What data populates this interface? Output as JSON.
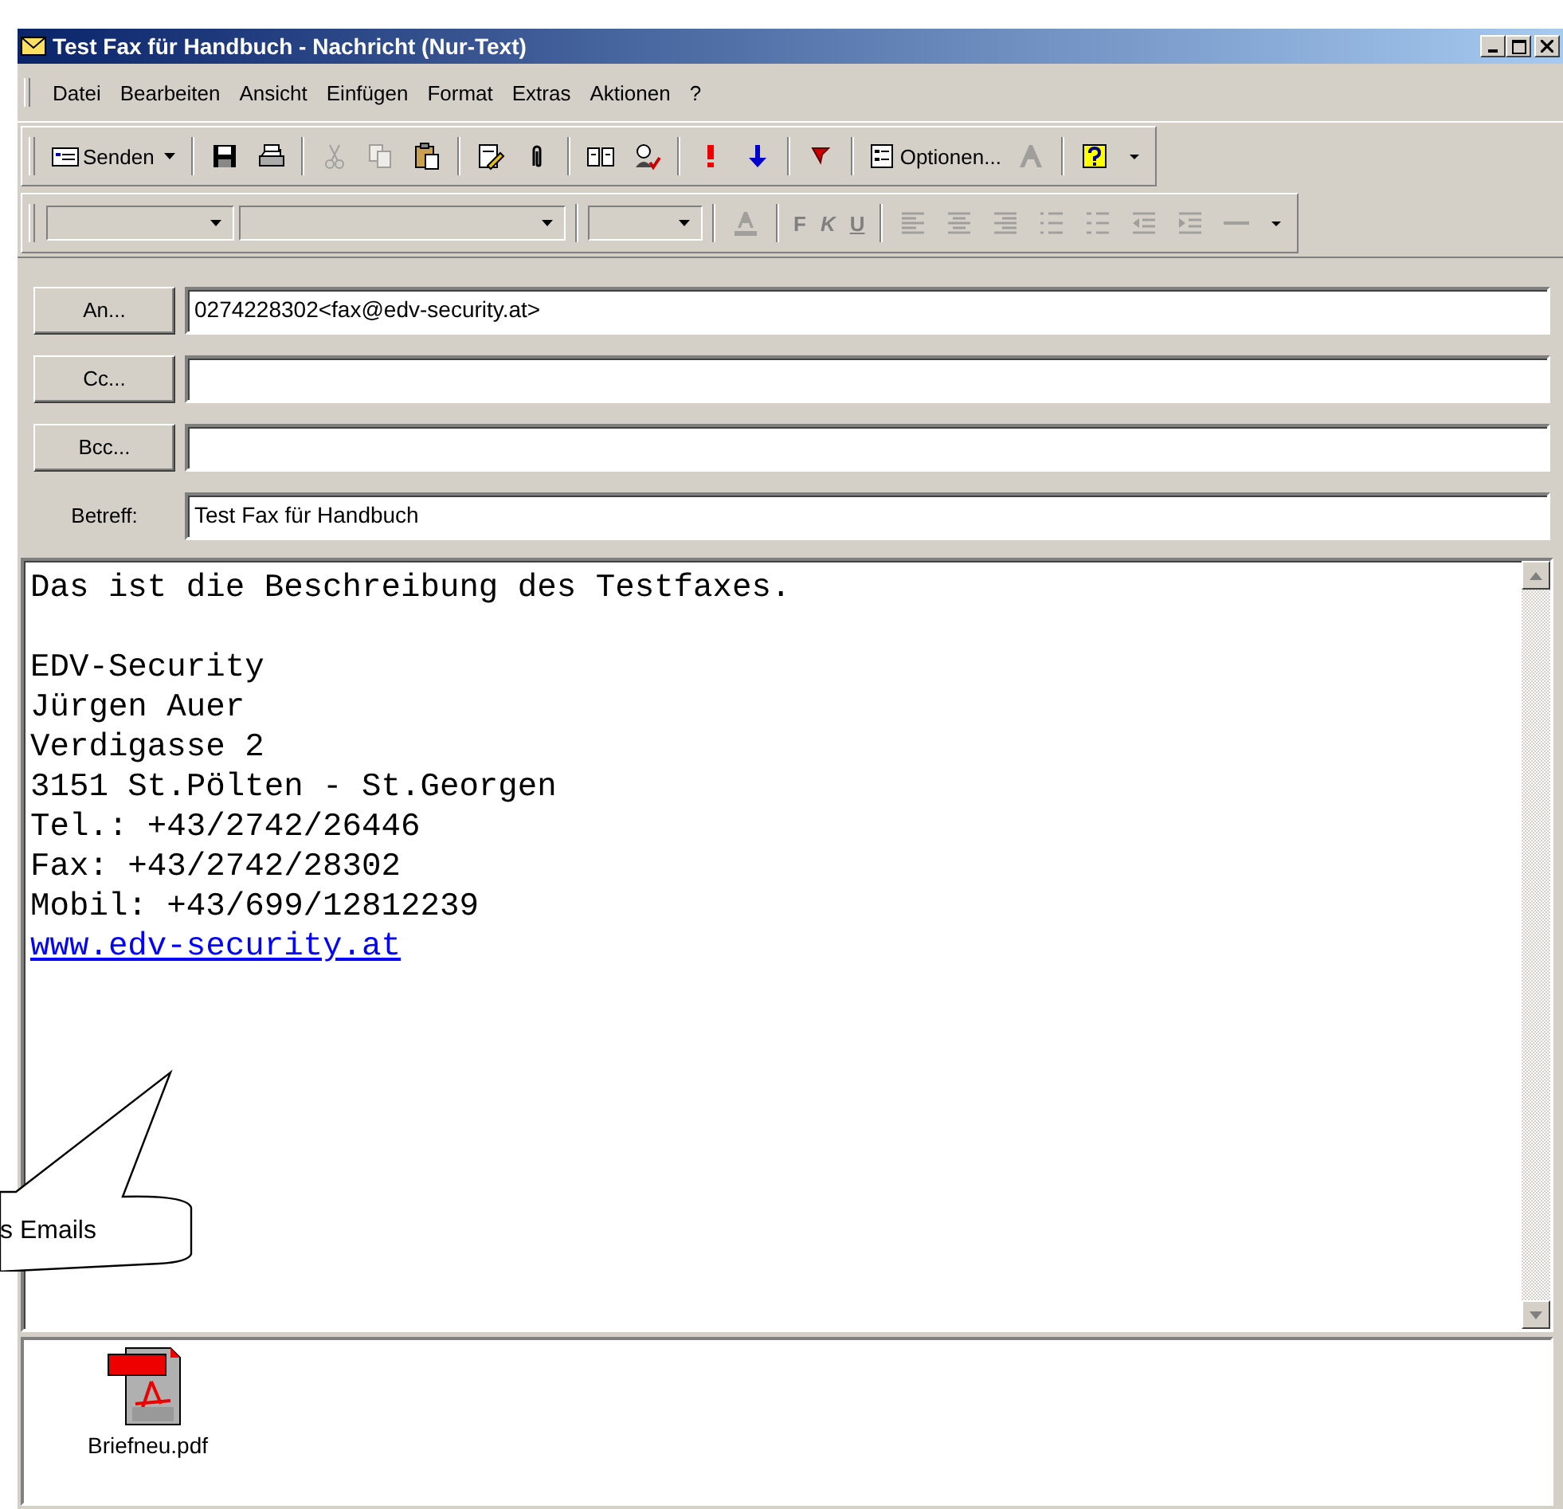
{
  "window": {
    "title": "Test Fax für Handbuch - Nachricht (Nur-Text)"
  },
  "menu": [
    "Datei",
    "Bearbeiten",
    "Ansicht",
    "Einfügen",
    "Format",
    "Extras",
    "Aktionen",
    "?"
  ],
  "toolbar": [
    {
      "kind": "send",
      "label": "Senden",
      "disabled": false
    },
    {
      "kind": "separator"
    },
    {
      "kind": "save",
      "disabled": false
    },
    {
      "kind": "print",
      "disabled": false
    },
    {
      "kind": "separator"
    },
    {
      "kind": "cut",
      "disabled": true
    },
    {
      "kind": "copy",
      "disabled": true
    },
    {
      "kind": "paste",
      "disabled": false
    },
    {
      "kind": "separator"
    },
    {
      "kind": "edit",
      "disabled": false
    },
    {
      "kind": "attach",
      "disabled": false
    },
    {
      "kind": "separator"
    },
    {
      "kind": "book",
      "disabled": false
    },
    {
      "kind": "checknames",
      "disabled": false
    },
    {
      "kind": "separator"
    },
    {
      "kind": "high",
      "disabled": false
    },
    {
      "kind": "low",
      "disabled": false
    },
    {
      "kind": "separator"
    },
    {
      "kind": "flag",
      "disabled": false
    },
    {
      "kind": "separator"
    },
    {
      "kind": "options",
      "label": "Optionen...",
      "disabled": false
    },
    {
      "kind": "font",
      "disabled": true
    },
    {
      "kind": "separator"
    },
    {
      "kind": "help",
      "disabled": false
    },
    {
      "kind": "more",
      "disabled": false
    }
  ],
  "format_toolbar": [
    {
      "kind": "combo",
      "disabled": true
    },
    {
      "kind": "combo",
      "disabled": true
    },
    {
      "kind": "separator"
    },
    {
      "kind": "combo",
      "disabled": true
    },
    {
      "kind": "separator"
    },
    {
      "kind": "fontcolor",
      "disabled": true
    },
    {
      "kind": "separator"
    },
    {
      "kind": "bold",
      "label": "F",
      "disabled": true
    },
    {
      "kind": "italic",
      "label": "K",
      "disabled": true
    },
    {
      "kind": "underline",
      "label": "U",
      "disabled": true
    },
    {
      "kind": "separator"
    },
    {
      "kind": "alignleft",
      "disabled": true
    },
    {
      "kind": "aligncenter",
      "disabled": true
    },
    {
      "kind": "alignright",
      "disabled": true
    },
    {
      "kind": "bullets",
      "disabled": true
    },
    {
      "kind": "numbering",
      "disabled": true
    },
    {
      "kind": "outdent",
      "disabled": true
    },
    {
      "kind": "indent",
      "disabled": true
    },
    {
      "kind": "rule",
      "disabled": true
    },
    {
      "kind": "more",
      "disabled": false
    }
  ],
  "fields": [
    {
      "kind": "button",
      "label": "An...",
      "value": "0274228302<fax@edv-security.at>"
    },
    {
      "kind": "button",
      "label": "Cc..."
    },
    {
      "kind": "button",
      "label": "Bcc..."
    },
    {
      "kind": "label",
      "label": "Betreff:",
      "value": "Test Fax für Handbuch"
    }
  ],
  "body": [
    {
      "kind": "text",
      "text": "Das ist die Beschreibung des Testfaxes."
    },
    {
      "kind": "blank"
    },
    {
      "kind": "text",
      "text": "EDV-Security"
    },
    {
      "kind": "text",
      "text": "Jürgen Auer"
    },
    {
      "kind": "text",
      "text": "Verdigasse 2"
    },
    {
      "kind": "text",
      "text": "3151 St.Pölten - St.Georgen"
    },
    {
      "kind": "text",
      "text": "Tel.: +43/2742/26446"
    },
    {
      "kind": "text",
      "text": "Fax: +43/2742/28302"
    },
    {
      "kind": "text",
      "text": "Mobil: +43/699/12812239"
    },
    {
      "kind": "link",
      "text": "www.edv-security.at"
    }
  ],
  "attachments": [
    {
      "kind": "pdf",
      "name": "Briefneu.pdf"
    }
  ],
  "callout": {
    "text": "s Emails"
  }
}
